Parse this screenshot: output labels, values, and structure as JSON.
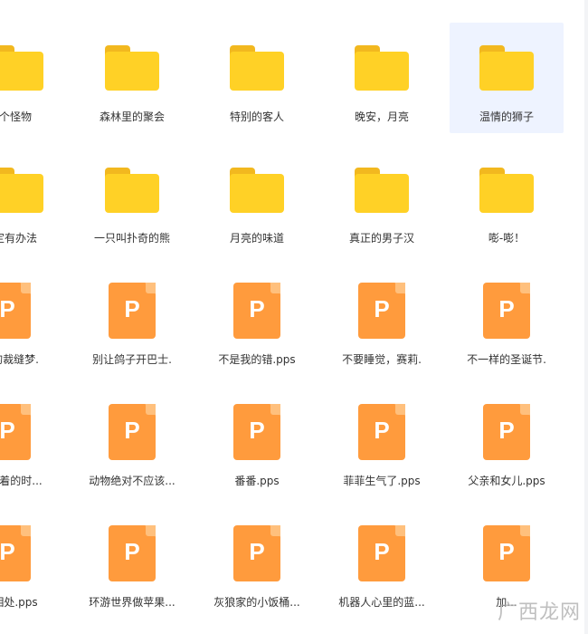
{
  "top_row_partial": [
    "",
    "",
    "",
    "",
    ""
  ],
  "row1": [
    {
      "label": "个怪物",
      "kind": "folder"
    },
    {
      "label": "森林里的聚会",
      "kind": "folder"
    },
    {
      "label": "特别的客人",
      "kind": "folder"
    },
    {
      "label": "晚安，月亮",
      "kind": "folder"
    },
    {
      "label": "温情的狮子",
      "kind": "folder",
      "selected": true
    }
  ],
  "row2": [
    {
      "label": "定有办法",
      "kind": "folder"
    },
    {
      "label": "一只叫扑奇的熊",
      "kind": "folder"
    },
    {
      "label": "月亮的味道",
      "kind": "folder"
    },
    {
      "label": "真正的男子汉",
      "kind": "folder"
    },
    {
      "label": "嘭-嘭！",
      "kind": "folder"
    }
  ],
  "row3": [
    {
      "label": "的裁缝梦.",
      "kind": "pps"
    },
    {
      "label": "别让鸽子开巴士.",
      "kind": "pps"
    },
    {
      "label": "不是我的错.pps",
      "kind": "pps"
    },
    {
      "label": "不要睡觉，赛莉.",
      "kind": "pps"
    },
    {
      "label": "不一样的圣诞节.",
      "kind": "pps"
    }
  ],
  "row4": [
    {
      "label": "不着的时...",
      "kind": "pps"
    },
    {
      "label": "动物绝对不应该...",
      "kind": "pps"
    },
    {
      "label": "番番.pps",
      "kind": "pps"
    },
    {
      "label": "菲菲生气了.pps",
      "kind": "pps"
    },
    {
      "label": "父亲和女儿.pps",
      "kind": "pps"
    }
  ],
  "row5": [
    {
      "label": "相处.pps",
      "kind": "pps"
    },
    {
      "label": "环游世界做苹果...",
      "kind": "pps"
    },
    {
      "label": "灰狼家的小饭桶...",
      "kind": "pps"
    },
    {
      "label": "机器人心里的蓝...",
      "kind": "pps"
    },
    {
      "label": "加...",
      "kind": "pps"
    }
  ],
  "icons": {
    "folder": "folder-icon",
    "pps": "pps-file-icon",
    "pps_letter": "P"
  },
  "colors": {
    "folder_body": "#ffd126",
    "folder_tab": "#f2b81f",
    "pps": "#ff9b3d",
    "pps_fold": "#ffc07d",
    "selected_bg": "#eef3ff",
    "label_text": "#333333"
  },
  "watermark": "广西龙网"
}
